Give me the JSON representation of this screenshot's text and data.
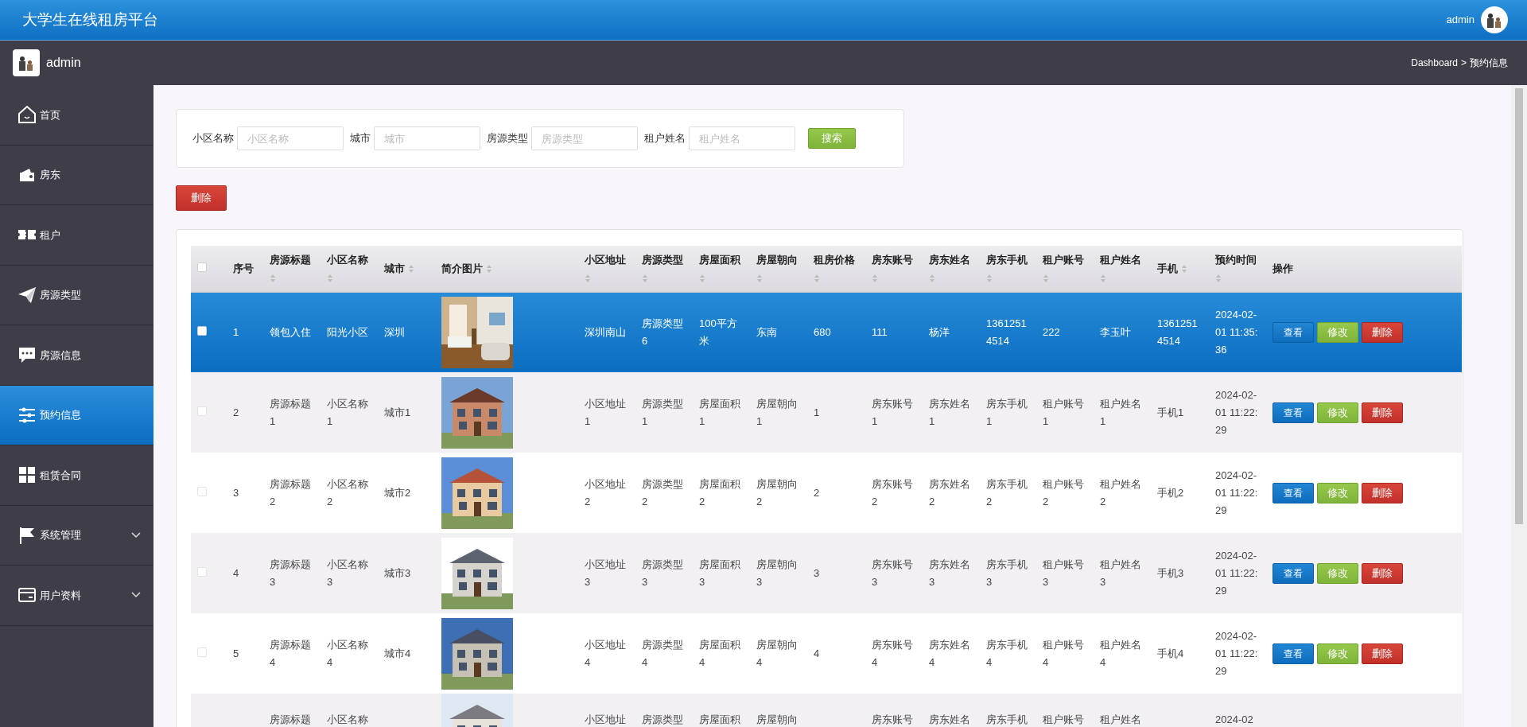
{
  "header": {
    "title": "大学生在线租房平台",
    "user": "admin"
  },
  "subbar": {
    "user": "admin",
    "breadcrumb": [
      "Dashboard",
      "预约信息"
    ],
    "separator": ">"
  },
  "sidebar": {
    "items": [
      {
        "label": "首页",
        "selected": false,
        "expandable": false
      },
      {
        "label": "房东",
        "selected": false,
        "expandable": false
      },
      {
        "label": "租户",
        "selected": false,
        "expandable": false
      },
      {
        "label": "房源类型",
        "selected": false,
        "expandable": false
      },
      {
        "label": "房源信息",
        "selected": false,
        "expandable": false
      },
      {
        "label": "预约信息",
        "selected": true,
        "expandable": false
      },
      {
        "label": "租赁合同",
        "selected": false,
        "expandable": false
      },
      {
        "label": "系统管理",
        "selected": false,
        "expandable": true
      },
      {
        "label": "用户资料",
        "selected": false,
        "expandable": true
      }
    ]
  },
  "search": {
    "fields": [
      {
        "label": "小区名称",
        "placeholder": "小区名称"
      },
      {
        "label": "城市",
        "placeholder": "城市"
      },
      {
        "label": "房源类型",
        "placeholder": "房源类型"
      },
      {
        "label": "租户姓名",
        "placeholder": "租户姓名"
      }
    ],
    "button": "搜索"
  },
  "delete_button": "删除",
  "table": {
    "select_all_checked": false,
    "columns": [
      {
        "label": "序号",
        "sortable": false
      },
      {
        "label": "房源标题",
        "sortable": true
      },
      {
        "label": "小区名称",
        "sortable": true
      },
      {
        "label": "城市",
        "sortable": true
      },
      {
        "label": "简介图片",
        "sortable": true
      },
      {
        "label": "小区地址",
        "sortable": true
      },
      {
        "label": "房源类型",
        "sortable": true
      },
      {
        "label": "房屋面积",
        "sortable": true
      },
      {
        "label": "房屋朝向",
        "sortable": true
      },
      {
        "label": "租房价格",
        "sortable": true
      },
      {
        "label": "房东账号",
        "sortable": true
      },
      {
        "label": "房东姓名",
        "sortable": true
      },
      {
        "label": "房东手机",
        "sortable": true
      },
      {
        "label": "租户账号",
        "sortable": true
      },
      {
        "label": "租户姓名",
        "sortable": true
      },
      {
        "label": "手机",
        "sortable": true
      },
      {
        "label": "预约时间",
        "sortable": true
      },
      {
        "label": "操作",
        "sortable": false
      }
    ],
    "rows": [
      {
        "selected": true,
        "checked": false,
        "cells": [
          "1",
          "领包入住",
          "阳光小区",
          "深圳",
          "",
          "深圳南山",
          "房源类型6",
          "100平方米",
          "东南",
          "680",
          "111",
          "杨洋",
          "13612514514",
          "222",
          "李玉叶",
          "13612514514",
          "2024-02-01 11:35:36"
        ],
        "actions": [
          "查看",
          "修改",
          "删除"
        ]
      },
      {
        "selected": false,
        "checked": false,
        "cells": [
          "2",
          "房源标题1",
          "小区名称1",
          "城市1",
          "",
          "小区地址1",
          "房源类型1",
          "房屋面积1",
          "房屋朝向1",
          "1",
          "房东账号1",
          "房东姓名1",
          "房东手机1",
          "租户账号1",
          "租户姓名1",
          "手机1",
          "2024-02-01 11:22:29"
        ],
        "actions": [
          "查看",
          "修改",
          "删除"
        ]
      },
      {
        "selected": false,
        "checked": false,
        "cells": [
          "3",
          "房源标题2",
          "小区名称2",
          "城市2",
          "",
          "小区地址2",
          "房源类型2",
          "房屋面积2",
          "房屋朝向2",
          "2",
          "房东账号2",
          "房东姓名2",
          "房东手机2",
          "租户账号2",
          "租户姓名2",
          "手机2",
          "2024-02-01 11:22:29"
        ],
        "actions": [
          "查看",
          "修改",
          "删除"
        ]
      },
      {
        "selected": false,
        "checked": false,
        "cells": [
          "4",
          "房源标题3",
          "小区名称3",
          "城市3",
          "",
          "小区地址3",
          "房源类型3",
          "房屋面积3",
          "房屋朝向3",
          "3",
          "房东账号3",
          "房东姓名3",
          "房东手机3",
          "租户账号3",
          "租户姓名3",
          "手机3",
          "2024-02-01 11:22:29"
        ],
        "actions": [
          "查看",
          "修改",
          "删除"
        ]
      },
      {
        "selected": false,
        "checked": false,
        "cells": [
          "5",
          "房源标题4",
          "小区名称4",
          "城市4",
          "",
          "小区地址4",
          "房源类型4",
          "房屋面积4",
          "房屋朝向4",
          "4",
          "房东账号4",
          "房东姓名4",
          "房东手机4",
          "租户账号4",
          "租户姓名4",
          "手机4",
          "2024-02-01 11:22:29"
        ],
        "actions": [
          "查看",
          "修改",
          "删除"
        ]
      },
      {
        "selected": false,
        "partial": true,
        "cells": [
          "",
          "房源标题",
          "小区名称",
          "",
          "",
          "小区地址",
          "房源类型",
          "房屋面积",
          "房屋朝向",
          "",
          "房东账号",
          "房东姓名",
          "房东手机",
          "租户账号",
          "租户姓名",
          "",
          "2024-02"
        ],
        "actions": []
      }
    ]
  }
}
